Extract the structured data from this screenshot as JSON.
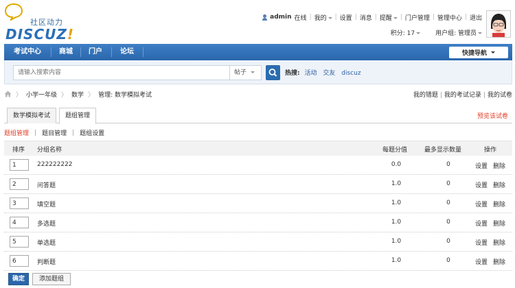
{
  "logo": {
    "subtitle": "社区动力",
    "wordmark": "DISCUZ",
    "wordmark_suffix": "!"
  },
  "toplinks": {
    "username": "admin",
    "status": "在线",
    "my": "我的",
    "settings": "设置",
    "messages": "消息",
    "reminders": "提醒",
    "portal_admin": "门户管理",
    "admin_center": "管理中心",
    "logout": "退出"
  },
  "userline": {
    "points": "积分: 17",
    "usergroup": "用户组: 管理员"
  },
  "nav": {
    "items": [
      "考试中心",
      "商城",
      "门户",
      "论坛"
    ],
    "quicknav": "快捷导航"
  },
  "search": {
    "placeholder": "请输入搜索内容",
    "type": "帖子",
    "hot_label": "热搜:",
    "hot_words": [
      "活动",
      "交友",
      "discuz"
    ]
  },
  "breadcrumb": {
    "items": [
      "小学一年级",
      "数学",
      "管理: 数学模拟考试"
    ]
  },
  "rightlinks": {
    "wrong": "我的错题",
    "records": "我的考试记录",
    "exams": "我的试卷"
  },
  "tabs": {
    "items": [
      "数学模拟考试",
      "题组管理"
    ],
    "active": 1,
    "preview": "预览该试卷"
  },
  "sublinks": {
    "items": [
      "题组管理",
      "题目管理",
      "题组设置"
    ]
  },
  "table": {
    "headers": {
      "order": "排序",
      "name": "分组名称",
      "score": "每题分值",
      "max": "最多显示数量",
      "ops": "操作"
    },
    "rows": [
      {
        "order": "1",
        "name": "222222222",
        "score": "0.0",
        "max": "0",
        "set": "设置",
        "del": "删除"
      },
      {
        "order": "2",
        "name": "问答题",
        "score": "1.0",
        "max": "0",
        "set": "设置",
        "del": "删除"
      },
      {
        "order": "3",
        "name": "填空题",
        "score": "1.0",
        "max": "0",
        "set": "设置",
        "del": "删除"
      },
      {
        "order": "4",
        "name": "多选题",
        "score": "1.0",
        "max": "0",
        "set": "设置",
        "del": "删除"
      },
      {
        "order": "5",
        "name": "单选题",
        "score": "1.0",
        "max": "0",
        "set": "设置",
        "del": "删除"
      },
      {
        "order": "6",
        "name": "判断题",
        "score": "1.0",
        "max": "0",
        "set": "设置",
        "del": "删除"
      }
    ]
  },
  "buttons": {
    "confirm": "确定",
    "add_group": "添加题组"
  },
  "icons": {
    "search": "search-icon",
    "home": "home-icon",
    "user": "user-icon",
    "avatar": "avatar"
  },
  "colors": {
    "nav_blue": "#2a66ab",
    "link_red": "#e0402a"
  }
}
